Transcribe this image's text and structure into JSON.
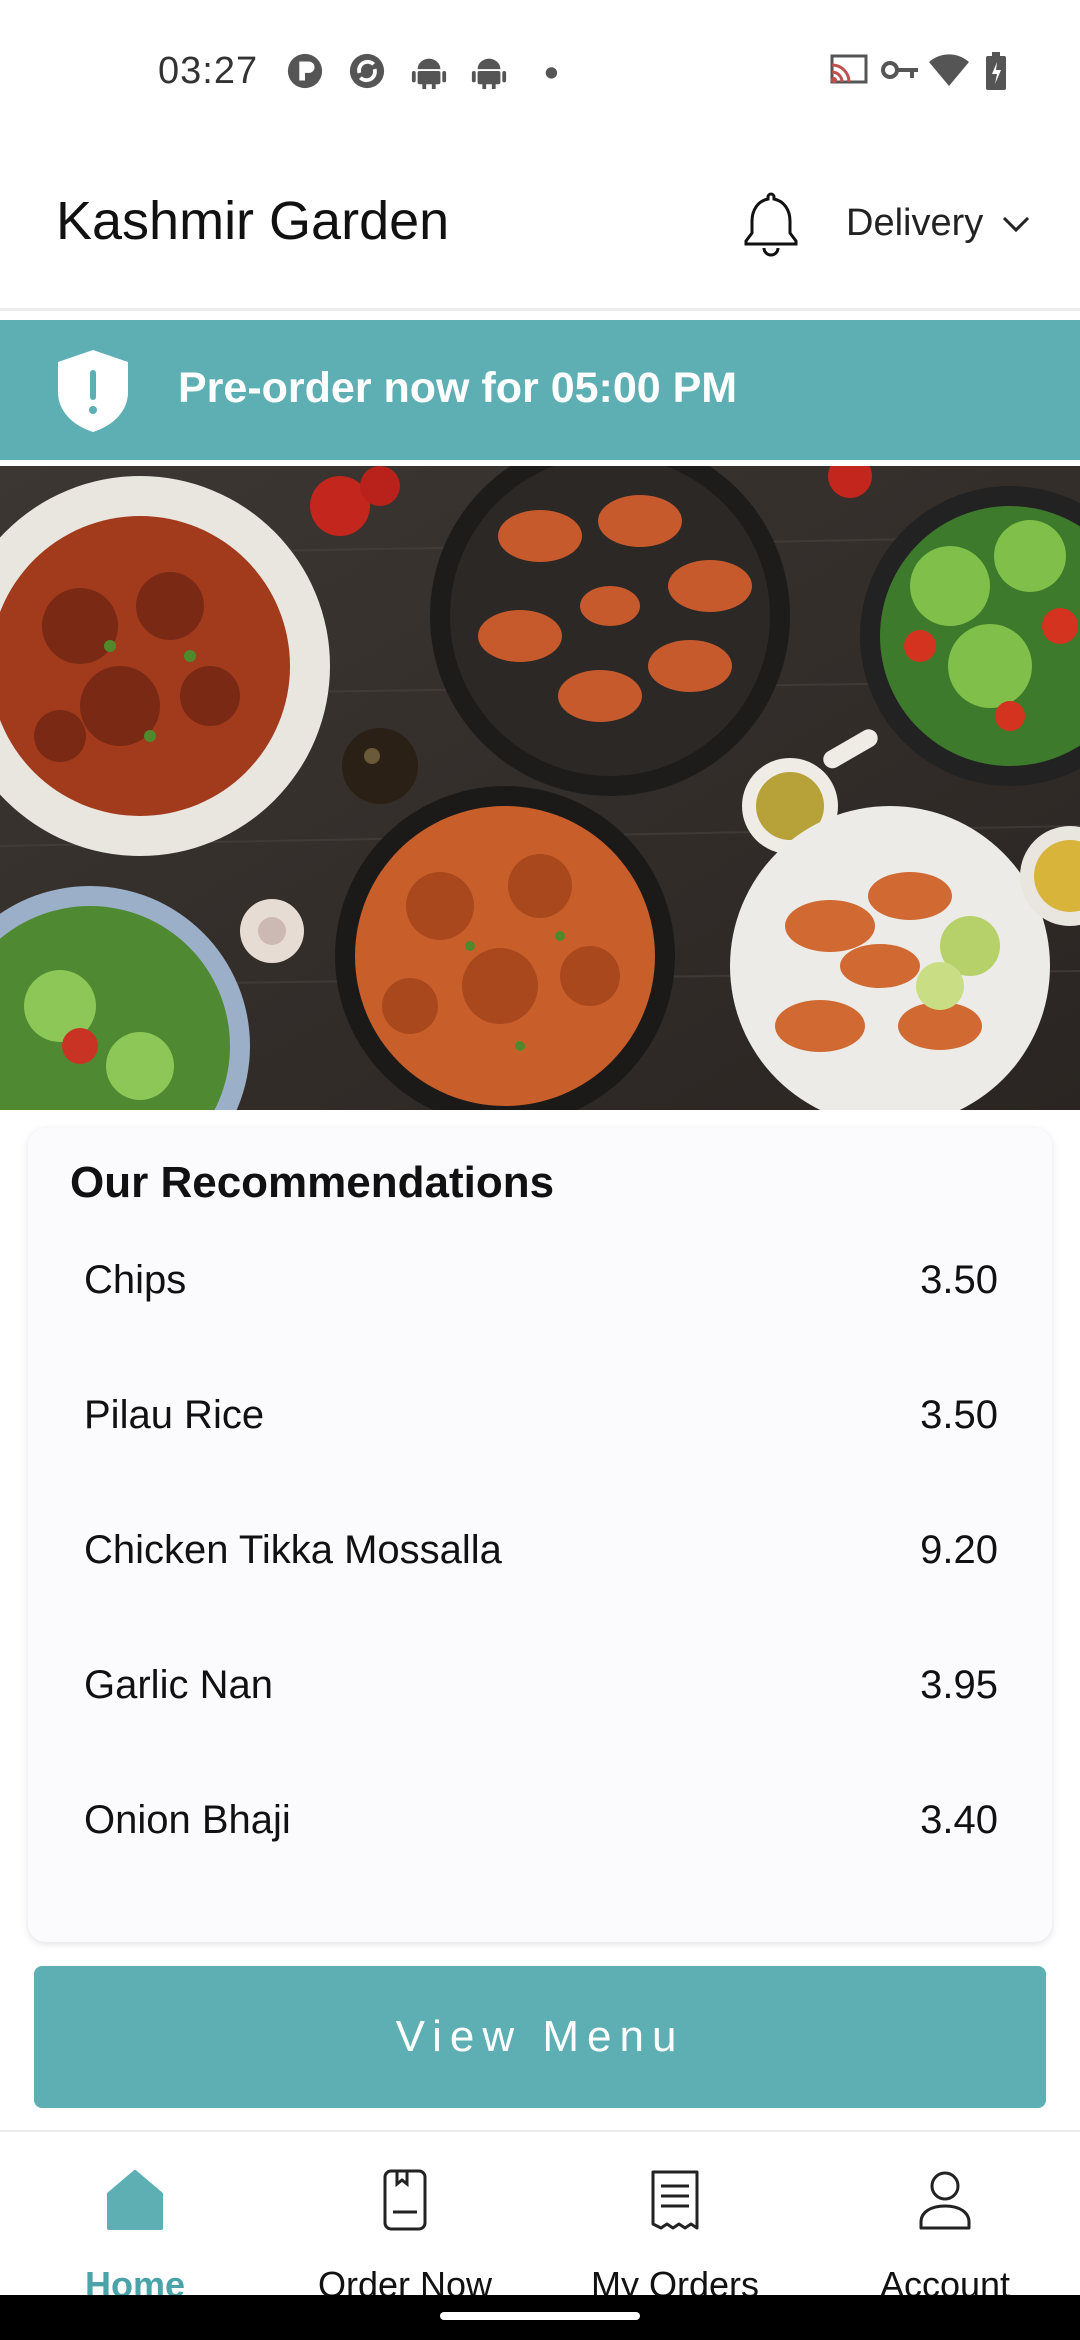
{
  "status_bar": {
    "time": "03:27"
  },
  "header": {
    "title": "Kashmir Garden",
    "mode_label": "Delivery"
  },
  "banner": {
    "text": "Pre-order now for 05:00 PM"
  },
  "recommendations": {
    "title": "Our Recommendations",
    "items": [
      {
        "name": "Chips",
        "price": "3.50"
      },
      {
        "name": "Pilau Rice",
        "price": "3.50"
      },
      {
        "name": "Chicken Tikka Mossalla",
        "price": "9.20"
      },
      {
        "name": "Garlic Nan",
        "price": "3.95"
      },
      {
        "name": "Onion Bhaji",
        "price": "3.40"
      }
    ]
  },
  "actions": {
    "view_menu": "View Menu"
  },
  "bottom_nav": {
    "items": [
      {
        "label": "Home",
        "icon": "home-icon",
        "active": true
      },
      {
        "label": "Order Now",
        "icon": "order-book-icon",
        "active": false
      },
      {
        "label": "My Orders",
        "icon": "receipt-icon",
        "active": false
      },
      {
        "label": "Account",
        "icon": "user-icon",
        "active": false
      }
    ]
  },
  "colors": {
    "accent": "#5dafb3",
    "active_nav": "#4aa3a8"
  }
}
